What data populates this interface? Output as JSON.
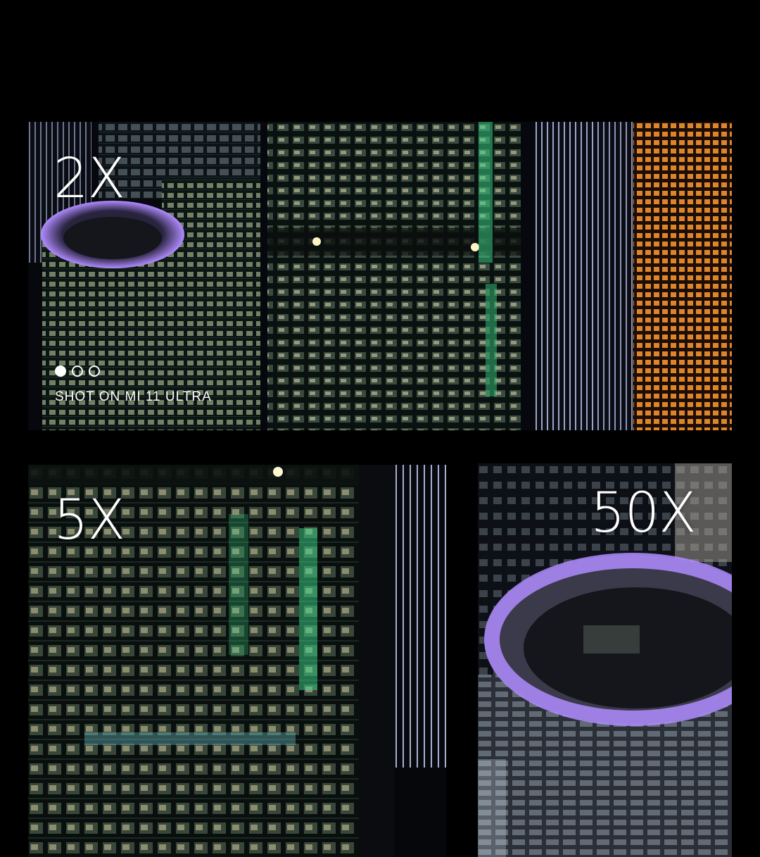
{
  "panels": {
    "two_x": {
      "label": "2X",
      "caption": "SHOT ON MI 11 ULTRA",
      "carousel": {
        "count": 3,
        "active_index": 0
      }
    },
    "five_x": {
      "label": "5X"
    },
    "fifty_x": {
      "label": "50X"
    }
  },
  "colors": {
    "background": "#000000",
    "label_text": "#ffffff",
    "window_warm": "#f0c070",
    "window_cool": "#dfe8ff",
    "window_green": "#66f0a0",
    "window_orange": "#ff9a30",
    "roof_light": "#b08cff"
  }
}
